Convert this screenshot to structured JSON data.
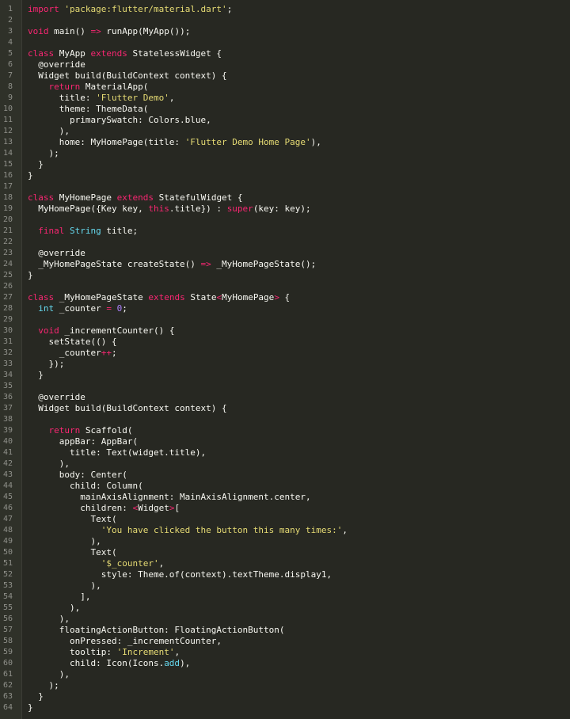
{
  "editor": {
    "language": "dart",
    "colors": {
      "background": "#272822",
      "gutter": "#2f3129",
      "line_number": "#8f908a",
      "text": "#f8f8f2",
      "keyword": "#f92672",
      "string": "#e6db74",
      "number": "#ae81ff",
      "constant": "#66d9ef"
    },
    "lines": [
      {
        "n": "1",
        "t": [
          [
            "k",
            "import"
          ],
          [
            "p",
            " "
          ],
          [
            "s",
            "'package:flutter/material.dart'"
          ],
          [
            "p",
            ";"
          ]
        ]
      },
      {
        "n": "2",
        "t": []
      },
      {
        "n": "3",
        "t": [
          [
            "k",
            "void"
          ],
          [
            "p",
            " main() "
          ],
          [
            "k",
            "=>"
          ],
          [
            "p",
            " runApp(MyApp());"
          ]
        ]
      },
      {
        "n": "4",
        "t": []
      },
      {
        "n": "5",
        "t": [
          [
            "k",
            "class"
          ],
          [
            "p",
            " MyApp "
          ],
          [
            "k",
            "extends"
          ],
          [
            "p",
            " StatelessWidget {"
          ]
        ]
      },
      {
        "n": "6",
        "t": [
          [
            "p",
            "  @override"
          ]
        ]
      },
      {
        "n": "7",
        "t": [
          [
            "p",
            "  Widget build(BuildContext context) {"
          ]
        ]
      },
      {
        "n": "8",
        "t": [
          [
            "p",
            "    "
          ],
          [
            "k",
            "return"
          ],
          [
            "p",
            " MaterialApp("
          ]
        ]
      },
      {
        "n": "9",
        "t": [
          [
            "p",
            "      title: "
          ],
          [
            "s",
            "'Flutter Demo'"
          ],
          [
            "p",
            ","
          ]
        ]
      },
      {
        "n": "10",
        "t": [
          [
            "p",
            "      theme: ThemeData("
          ]
        ]
      },
      {
        "n": "11",
        "t": [
          [
            "p",
            "        primarySwatch: Colors.blue,"
          ]
        ]
      },
      {
        "n": "12",
        "t": [
          [
            "p",
            "      ),"
          ]
        ]
      },
      {
        "n": "13",
        "t": [
          [
            "p",
            "      home: MyHomePage(title: "
          ],
          [
            "s",
            "'Flutter Demo Home Page'"
          ],
          [
            "p",
            "),"
          ]
        ]
      },
      {
        "n": "14",
        "t": [
          [
            "p",
            "    );"
          ]
        ]
      },
      {
        "n": "15",
        "t": [
          [
            "p",
            "  }"
          ]
        ]
      },
      {
        "n": "16",
        "t": [
          [
            "p",
            "}"
          ]
        ]
      },
      {
        "n": "17",
        "t": []
      },
      {
        "n": "18",
        "t": [
          [
            "k",
            "class"
          ],
          [
            "p",
            " MyHomePage "
          ],
          [
            "k",
            "extends"
          ],
          [
            "p",
            " StatefulWidget {"
          ]
        ]
      },
      {
        "n": "19",
        "t": [
          [
            "p",
            "  MyHomePage({Key key, "
          ],
          [
            "k",
            "this"
          ],
          [
            "p",
            ".title}) : "
          ],
          [
            "k",
            "super"
          ],
          [
            "p",
            "(key: key);"
          ]
        ]
      },
      {
        "n": "20",
        "t": []
      },
      {
        "n": "21",
        "t": [
          [
            "p",
            "  "
          ],
          [
            "k",
            "final"
          ],
          [
            "p",
            " "
          ],
          [
            "c",
            "String"
          ],
          [
            "p",
            " title;"
          ]
        ]
      },
      {
        "n": "22",
        "t": []
      },
      {
        "n": "23",
        "t": [
          [
            "p",
            "  @override"
          ]
        ]
      },
      {
        "n": "24",
        "t": [
          [
            "p",
            "  _MyHomePageState createState() "
          ],
          [
            "k",
            "=>"
          ],
          [
            "p",
            " _MyHomePageState();"
          ]
        ]
      },
      {
        "n": "25",
        "t": [
          [
            "p",
            "}"
          ]
        ]
      },
      {
        "n": "26",
        "t": []
      },
      {
        "n": "27",
        "t": [
          [
            "k",
            "class"
          ],
          [
            "p",
            " _MyHomePageState "
          ],
          [
            "k",
            "extends"
          ],
          [
            "p",
            " State"
          ],
          [
            "k",
            "<"
          ],
          [
            "p",
            "MyHomePage"
          ],
          [
            "k",
            ">"
          ],
          [
            "p",
            " {"
          ]
        ]
      },
      {
        "n": "28",
        "t": [
          [
            "p",
            "  "
          ],
          [
            "c",
            "int"
          ],
          [
            "p",
            " _counter "
          ],
          [
            "k",
            "="
          ],
          [
            "p",
            " "
          ],
          [
            "n",
            "0"
          ],
          [
            "p",
            ";"
          ]
        ]
      },
      {
        "n": "29",
        "t": []
      },
      {
        "n": "30",
        "t": [
          [
            "p",
            "  "
          ],
          [
            "k",
            "void"
          ],
          [
            "p",
            " _incrementCounter() {"
          ]
        ]
      },
      {
        "n": "31",
        "t": [
          [
            "p",
            "    setState(() {"
          ]
        ]
      },
      {
        "n": "32",
        "t": [
          [
            "p",
            "      _counter"
          ],
          [
            "k",
            "++"
          ],
          [
            "p",
            ";"
          ]
        ]
      },
      {
        "n": "33",
        "t": [
          [
            "p",
            "    });"
          ]
        ]
      },
      {
        "n": "34",
        "t": [
          [
            "p",
            "  }"
          ]
        ]
      },
      {
        "n": "35",
        "t": []
      },
      {
        "n": "36",
        "t": [
          [
            "p",
            "  @override"
          ]
        ]
      },
      {
        "n": "37",
        "t": [
          [
            "p",
            "  Widget build(BuildContext context) {"
          ]
        ]
      },
      {
        "n": "38",
        "t": []
      },
      {
        "n": "39",
        "t": [
          [
            "p",
            "    "
          ],
          [
            "k",
            "return"
          ],
          [
            "p",
            " Scaffold("
          ]
        ]
      },
      {
        "n": "40",
        "t": [
          [
            "p",
            "      appBar: AppBar("
          ]
        ]
      },
      {
        "n": "41",
        "t": [
          [
            "p",
            "        title: Text(widget.title),"
          ]
        ]
      },
      {
        "n": "42",
        "t": [
          [
            "p",
            "      ),"
          ]
        ]
      },
      {
        "n": "43",
        "t": [
          [
            "p",
            "      body: Center("
          ]
        ]
      },
      {
        "n": "44",
        "t": [
          [
            "p",
            "        child: Column("
          ]
        ]
      },
      {
        "n": "45",
        "t": [
          [
            "p",
            "          mainAxisAlignment: MainAxisAlignment.center,"
          ]
        ]
      },
      {
        "n": "46",
        "t": [
          [
            "p",
            "          children: "
          ],
          [
            "k",
            "<"
          ],
          [
            "p",
            "Widget"
          ],
          [
            "k",
            ">"
          ],
          [
            "p",
            "["
          ]
        ]
      },
      {
        "n": "47",
        "t": [
          [
            "p",
            "            Text("
          ]
        ]
      },
      {
        "n": "48",
        "t": [
          [
            "p",
            "              "
          ],
          [
            "s",
            "'You have clicked the button this many times:'"
          ],
          [
            "p",
            ","
          ]
        ]
      },
      {
        "n": "49",
        "t": [
          [
            "p",
            "            ),"
          ]
        ]
      },
      {
        "n": "50",
        "t": [
          [
            "p",
            "            Text("
          ]
        ]
      },
      {
        "n": "51",
        "t": [
          [
            "p",
            "              "
          ],
          [
            "s",
            "'$_counter'"
          ],
          [
            "p",
            ","
          ]
        ]
      },
      {
        "n": "52",
        "t": [
          [
            "p",
            "              style: Theme.of(context).textTheme.display1,"
          ]
        ]
      },
      {
        "n": "53",
        "t": [
          [
            "p",
            "            ),"
          ]
        ]
      },
      {
        "n": "54",
        "t": [
          [
            "p",
            "          ],"
          ]
        ]
      },
      {
        "n": "55",
        "t": [
          [
            "p",
            "        ),"
          ]
        ]
      },
      {
        "n": "56",
        "t": [
          [
            "p",
            "      ),"
          ]
        ]
      },
      {
        "n": "57",
        "t": [
          [
            "p",
            "      floatingActionButton: FloatingActionButton("
          ]
        ]
      },
      {
        "n": "58",
        "t": [
          [
            "p",
            "        onPressed: _incrementCounter,"
          ]
        ]
      },
      {
        "n": "59",
        "t": [
          [
            "p",
            "        tooltip: "
          ],
          [
            "s",
            "'Increment'"
          ],
          [
            "p",
            ","
          ]
        ]
      },
      {
        "n": "60",
        "t": [
          [
            "p",
            "        child: Icon(Icons."
          ],
          [
            "c",
            "add"
          ],
          [
            "p",
            "),"
          ]
        ]
      },
      {
        "n": "61",
        "t": [
          [
            "p",
            "      ),"
          ]
        ]
      },
      {
        "n": "62",
        "t": [
          [
            "p",
            "    );"
          ]
        ]
      },
      {
        "n": "63",
        "t": [
          [
            "p",
            "  }"
          ]
        ]
      },
      {
        "n": "64",
        "t": [
          [
            "p",
            "}"
          ]
        ]
      }
    ]
  }
}
